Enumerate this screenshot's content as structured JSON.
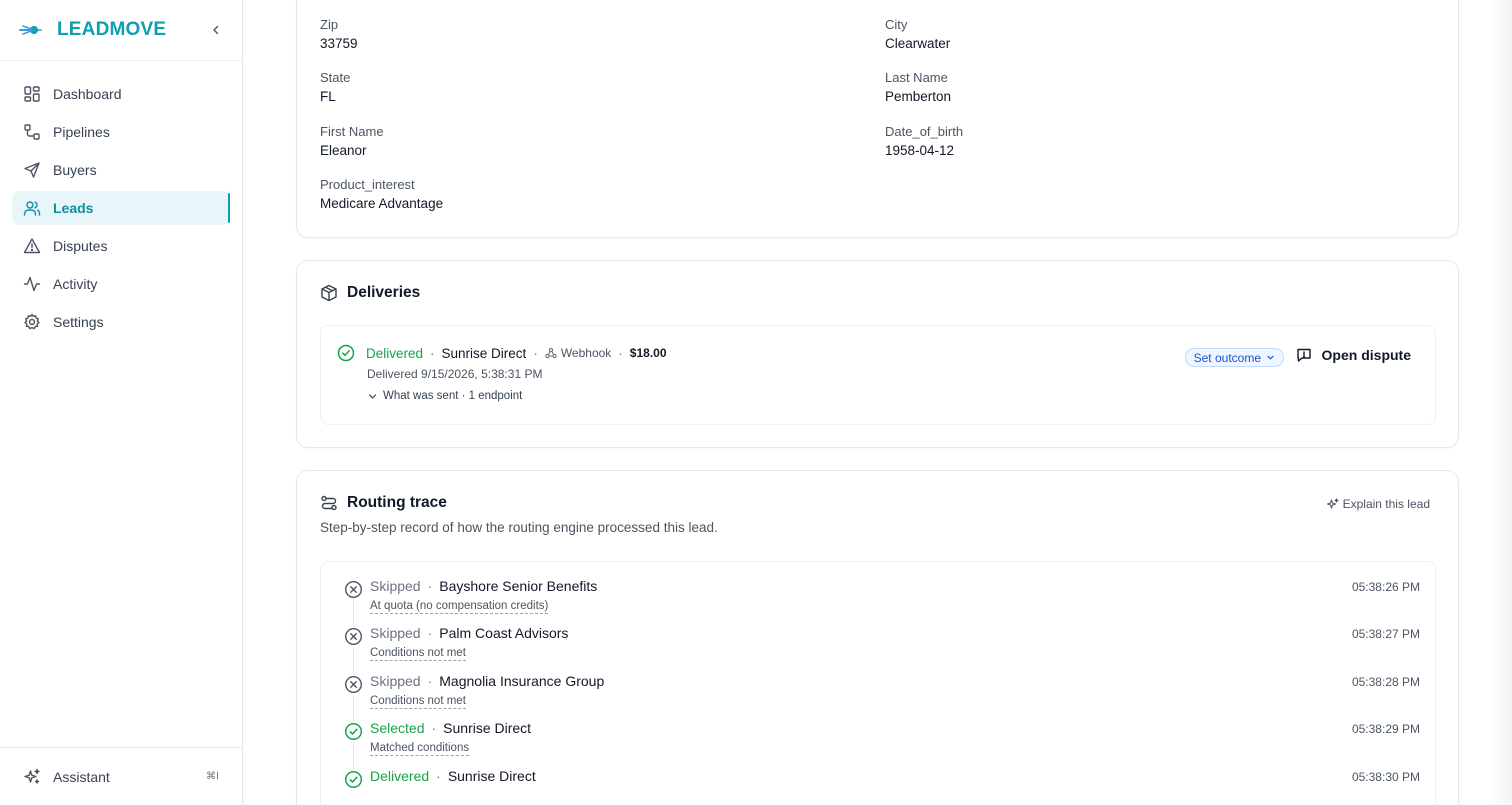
{
  "brand": {
    "name": "LEADMOVE"
  },
  "sidebar": {
    "items": [
      {
        "label": "Dashboard",
        "icon": "grid-icon"
      },
      {
        "label": "Pipelines",
        "icon": "workflow-icon"
      },
      {
        "label": "Buyers",
        "icon": "send-icon"
      },
      {
        "label": "Leads",
        "icon": "users-icon",
        "active": true
      },
      {
        "label": "Disputes",
        "icon": "alert-triangle-icon"
      },
      {
        "label": "Activity",
        "icon": "activity-icon"
      },
      {
        "label": "Settings",
        "icon": "gear-icon"
      }
    ],
    "assistant": {
      "label": "Assistant",
      "shortcut": "⌘I"
    }
  },
  "fields": [
    {
      "label": "Zip",
      "value": "33759"
    },
    {
      "label": "City",
      "value": "Clearwater"
    },
    {
      "label": "State",
      "value": "FL"
    },
    {
      "label": "Last Name",
      "value": "Pemberton"
    },
    {
      "label": "First Name",
      "value": "Eleanor"
    },
    {
      "label": "Date_of_birth",
      "value": "1958-04-12"
    },
    {
      "label": "Product_interest",
      "value": "Medicare Advantage"
    }
  ],
  "deliveries": {
    "title": "Deliveries",
    "item": {
      "status": "Delivered",
      "buyer": "Sunrise Direct",
      "method": "Webhook",
      "price": "$18.00",
      "delivered_at": "Delivered 9/15/2026, 5:38:31 PM",
      "details_label": "What was sent · 1 endpoint",
      "set_outcome_label": "Set outcome",
      "open_dispute_label": "Open dispute"
    }
  },
  "routing": {
    "title": "Routing trace",
    "subtitle": "Step-by-step record of how the routing engine processed this lead.",
    "explain_label": "Explain this lead",
    "steps": [
      {
        "status": "Skipped",
        "buyer": "Bayshore Senior Benefits",
        "reason": "At quota (no compensation credits)",
        "time": "05:38:26 PM",
        "kind": "skipped"
      },
      {
        "status": "Skipped",
        "buyer": "Palm Coast Advisors",
        "reason": "Conditions not met",
        "time": "05:38:27 PM",
        "kind": "skipped"
      },
      {
        "status": "Skipped",
        "buyer": "Magnolia Insurance Group",
        "reason": "Conditions not met",
        "time": "05:38:28 PM",
        "kind": "skipped"
      },
      {
        "status": "Selected",
        "buyer": "Sunrise Direct",
        "reason": "Matched conditions",
        "time": "05:38:29 PM",
        "kind": "ok"
      },
      {
        "status": "Delivered",
        "buyer": "Sunrise Direct",
        "reason": "",
        "time": "05:38:30 PM",
        "kind": "ok"
      }
    ]
  },
  "colors": {
    "brand": "#0e9fb0",
    "success": "#16a34a",
    "muted": "#6b7280"
  }
}
